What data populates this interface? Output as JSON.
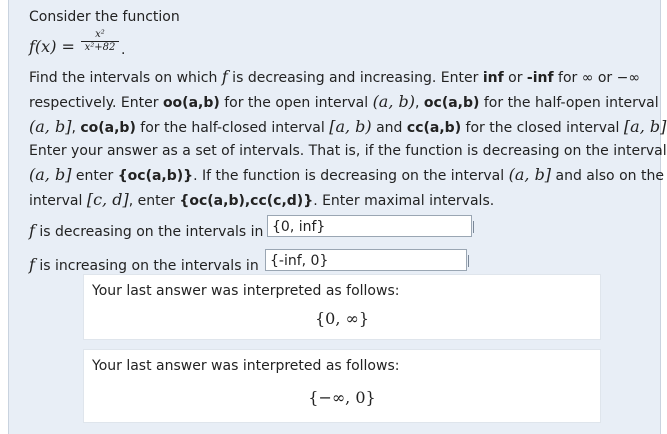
{
  "problem": {
    "intro": "Consider the function",
    "function_lhs": "f(x) =",
    "numerator": "x²",
    "denominator": "x²+82",
    "line1_a": "Find the intervals on which ",
    "line1_f": "f",
    "line1_b": " is decreasing and increasing. Enter ",
    "inf": "inf",
    "line1_c": " or ",
    "neg_inf": "-inf",
    "line1_d": " for ∞ or −∞",
    "line2_a": "respectively. Enter ",
    "oo": "oo(a,b)",
    "line2_b": " for the open interval ",
    "open_interval": "(a, b)",
    "line2_c": ", ",
    "oc": "oc(a,b)",
    "line2_d": " for the half-open interval",
    "half_open_interval": "(a, b]",
    "line3_a": ", ",
    "co": "co(a,b)",
    "line3_b": " for the half-closed interval ",
    "half_closed_interval": "[a, b)",
    "line3_c": " and ",
    "cc": "cc(a,b)",
    "line3_d": " for the closed interval ",
    "closed_interval": "[a, b]",
    "line3_e": ".",
    "line4": "Enter your answer as a set of intervals. That is, if the function is decreasing on the interval",
    "ex_interval1": "(a, b]",
    "line5_a": " enter ",
    "ex_answer1": "{oc(a,b)}",
    "line5_b": ". If the function is decreasing on the interval ",
    "ex_interval2": "(a, b]",
    "line5_c": " and also on the",
    "line6_a": "interval ",
    "ex_interval3": "[c, d]",
    "line6_b": ", enter ",
    "ex_answer2": "{oc(a,b),cc(c,d)}",
    "line6_c": ". Enter maximal intervals."
  },
  "answers": {
    "decreasing_label_f": "f",
    "decreasing_label": " is decreasing on the intervals in",
    "decreasing_value": "{0, inf}",
    "increasing_label_f": "f",
    "increasing_label": " is increasing on the intervals in",
    "increasing_value": "{-inf, 0}"
  },
  "feedback": [
    {
      "message": "Your last answer was interpreted as follows:",
      "value": "{0, ∞}"
    },
    {
      "message": "Your last answer was interpreted as follows:",
      "value": "{−∞, 0}"
    }
  ]
}
